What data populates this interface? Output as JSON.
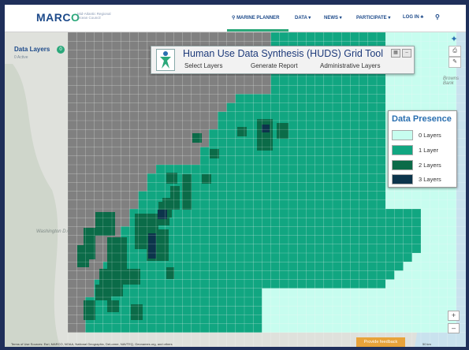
{
  "topnav": {
    "logo": "MARC",
    "logo_o": "O",
    "tagline": "Mid-Atlantic Regional Ocean Council",
    "items": [
      "MARINE PLANNER",
      "DATA ▾",
      "NEWS ▾",
      "PARTICIPATE ▾",
      "LOG IN ♣"
    ],
    "search_icon": "search-icon"
  },
  "map": {
    "data_layers_label": "Data Layers",
    "data_layers_count": "0",
    "active_label": "0 Active",
    "land_labels": [
      "Washington D.C.",
      "Browns Bank"
    ]
  },
  "huds": {
    "title": "Human Use Data Synthesis (HUDS) Grid Tool",
    "menu": [
      "Select Layers",
      "Generate Report",
      "Administrative Layers"
    ]
  },
  "legend": {
    "title": "Data Presence",
    "items": [
      {
        "label": "0 Layers",
        "color": "#c7fdef"
      },
      {
        "label": "1 Layer",
        "color": "#11a681"
      },
      {
        "label": "2 Layers",
        "color": "#0b6b48"
      },
      {
        "label": "3 Layers",
        "color": "#0c344b"
      }
    ]
  },
  "colors": {
    "nodata": "#808080",
    "l0": "#c7fdef",
    "l1": "#11a681",
    "l2": "#0b6b48",
    "l3": "#0c344b"
  },
  "footer": {
    "attribution": "Terms of Use  Sources: Esri, MARCO, NOAA, National Geographic, DeLorme, NAVTEQ, Geonames.org, and others",
    "feedback": "Provide feedback",
    "scale": "50 km"
  }
}
